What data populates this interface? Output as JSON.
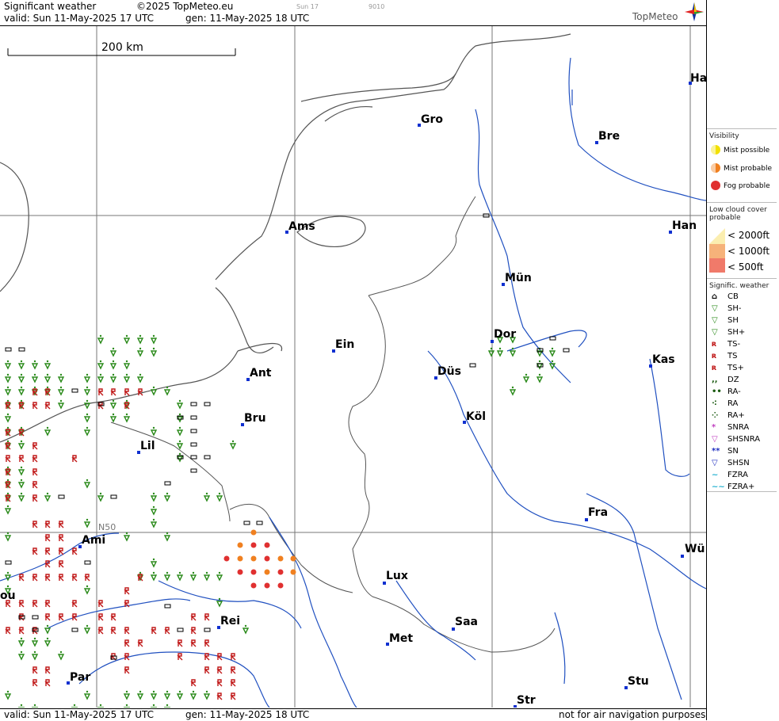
{
  "header": {
    "title": "Significant weather",
    "copyright": "©2025 TopMeteo.eu",
    "run_code": "Sun 17",
    "code2": "9010",
    "valid": "valid:  Sun  11-May-2025  17 UTC",
    "generated": "gen: 11-May-2025 18 UTC",
    "brand": "TopMeteo"
  },
  "footer": {
    "valid": "valid:  Sun  11-May-2025  17 UTC",
    "generated": "gen: 11-May-2025 18 UTC",
    "disclaimer": "not for air navigation purposes"
  },
  "map": {
    "scale_label": "200 km",
    "grid_label": "N50",
    "cities": [
      {
        "name": "Ha"
      },
      {
        "name": "Gro"
      },
      {
        "name": "Bre"
      },
      {
        "name": "Ams"
      },
      {
        "name": "Han"
      },
      {
        "name": "Mün"
      },
      {
        "name": "Dor"
      },
      {
        "name": "Ein"
      },
      {
        "name": "Kas"
      },
      {
        "name": "Ant"
      },
      {
        "name": "Düs"
      },
      {
        "name": "Bru"
      },
      {
        "name": "Köl"
      },
      {
        "name": "Lil"
      },
      {
        "name": "Fra"
      },
      {
        "name": "Ami"
      },
      {
        "name": "Wü"
      },
      {
        "name": "Lux"
      },
      {
        "name": "Rei"
      },
      {
        "name": "Saa"
      },
      {
        "name": "Met"
      },
      {
        "name": "Par"
      },
      {
        "name": "Stu"
      },
      {
        "name": "Str"
      },
      {
        "name": "ou"
      }
    ]
  },
  "legend": {
    "visibility_title": "Visibility",
    "visibility_items": [
      {
        "label": "Mist possible",
        "color": "#f2e000"
      },
      {
        "label": "Mist probable",
        "color": "#f08020"
      },
      {
        "label": "Fog probable",
        "color": "#e03030"
      }
    ],
    "lowcloud_title_1": "Low cloud cover",
    "lowcloud_title_2": "probable",
    "lowcloud_items": [
      "< 2000ft",
      "< 1000ft",
      "<   500ft"
    ],
    "sigwx_title": "Signific. weather",
    "sigwx_items": [
      {
        "label": "CB",
        "icon": "cb-icon",
        "color": "#000000"
      },
      {
        "label": "SH-",
        "icon": "shower-light-icon",
        "color": "#2a8a1a"
      },
      {
        "label": "SH",
        "icon": "shower-icon",
        "color": "#2a8a1a"
      },
      {
        "label": "SH+",
        "icon": "shower-heavy-icon",
        "color": "#2a8a1a"
      },
      {
        "label": "TS-",
        "icon": "thunder-light-icon",
        "color": "#c01818"
      },
      {
        "label": "TS",
        "icon": "thunder-icon",
        "color": "#c01818"
      },
      {
        "label": "TS+",
        "icon": "thunder-heavy-icon",
        "color": "#c01818"
      },
      {
        "label": "DZ",
        "icon": "drizzle-icon",
        "color": "#1a5a10"
      },
      {
        "label": "RA-",
        "icon": "rain-light-icon",
        "color": "#1a5a10"
      },
      {
        "label": "RA",
        "icon": "rain-icon",
        "color": "#1a5a10"
      },
      {
        "label": "RA+",
        "icon": "rain-heavy-icon",
        "color": "#1a5a10"
      },
      {
        "label": "SNRA",
        "icon": "sleet-icon",
        "color": "#c040c0"
      },
      {
        "label": "SHSNRA",
        "icon": "sleet-shower-icon",
        "color": "#c040c0"
      },
      {
        "label": "SN",
        "icon": "snow-icon",
        "color": "#2030c0"
      },
      {
        "label": "SHSN",
        "icon": "snow-shower-icon",
        "color": "#2030c0"
      },
      {
        "label": "FZRA",
        "icon": "freezing-rain-icon",
        "color": "#20b0d0"
      },
      {
        "label": "FZRA+",
        "icon": "freezing-rain-heavy-icon",
        "color": "#20b0d0"
      }
    ]
  }
}
